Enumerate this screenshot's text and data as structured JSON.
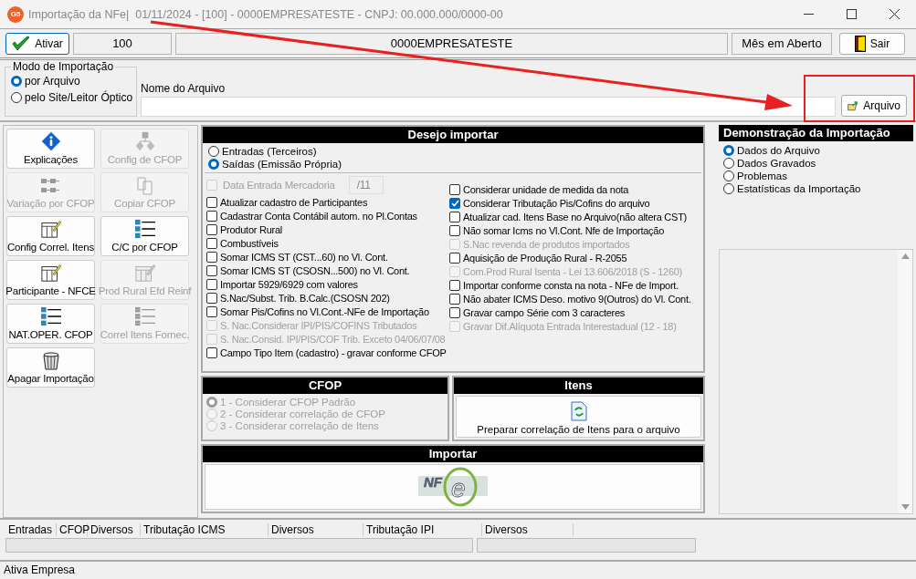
{
  "window": {
    "app_icon": "G5",
    "title": "Importação da NFe|  01/11/2024 - [100] - 0000EMPRESATESTE - CNPJ: 00.000.000/0000-00"
  },
  "toolbar": {
    "activate_button": "Ativar",
    "company_code": "100",
    "company_name": "0000EMPRESATESTE",
    "period_status": "Mês em Aberto",
    "exit_button": "Sair"
  },
  "import_mode": {
    "title": "Modo de Importação",
    "options": [
      {
        "label": "por Arquivo",
        "selected": true
      },
      {
        "label": "pelo Site/Leitor Óptico",
        "selected": false
      }
    ]
  },
  "file": {
    "label": "Nome do Arquivo",
    "button": "Arquivo"
  },
  "actions": [
    {
      "label": "Explicações",
      "disabled": false
    },
    {
      "label": "Config de CFOP",
      "disabled": true
    },
    {
      "label": "Variação por CFOP",
      "disabled": true
    },
    {
      "label": "Copiar CFOP",
      "disabled": true
    },
    {
      "label": "Config Correl. Itens",
      "disabled": false
    },
    {
      "label": "C/C por CFOP",
      "disabled": false
    },
    {
      "label": "Participante - NFCE",
      "disabled": false
    },
    {
      "label": "Prod Rural Efd Reinf",
      "disabled": true
    },
    {
      "label": "NAT.OPER. CFOP",
      "disabled": false
    },
    {
      "label": "Correl Itens Fornec.",
      "disabled": true
    },
    {
      "label": "Apagar Importação",
      "disabled": false
    }
  ],
  "import_options": {
    "title": "Desejo importar",
    "types": [
      {
        "label": "Entradas (Terceiros)",
        "selected": false
      },
      {
        "label": "Saídas (Emissão Própria)",
        "selected": true
      }
    ],
    "date_field": {
      "label": "Data Entrada Mercadoria",
      "value": "/11",
      "checked": false,
      "disabled": true
    },
    "left": [
      {
        "label": "Atualizar cadastro de Participantes",
        "checked": false,
        "disabled": false
      },
      {
        "label": "Cadastrar Conta Contábil autom. no Pl.Contas",
        "checked": false,
        "disabled": false
      },
      {
        "label": "Produtor Rural",
        "checked": false,
        "disabled": false
      },
      {
        "label": "Combustíveis",
        "checked": false,
        "disabled": false
      },
      {
        "label": "Somar ICMS ST (CST...60) no Vl. Cont.",
        "checked": false,
        "disabled": false
      },
      {
        "label": "Somar ICMS ST (CSOSN...500) no Vl. Cont.",
        "checked": false,
        "disabled": false
      },
      {
        "label": "Importar 5929/6929 com valores",
        "checked": false,
        "disabled": false
      },
      {
        "label": "S.Nac/Subst. Trib. B.Calc.(CSOSN 202)",
        "checked": false,
        "disabled": false
      },
      {
        "label": "Somar Pis/Cofins no Vl.Cont.-NFe de Importação",
        "checked": false,
        "disabled": false
      },
      {
        "label": "S. Nac.Considerar IPI/PIS/COFINS Tributados",
        "checked": false,
        "disabled": true
      },
      {
        "label": "S. Nac.Consid. IPI/PIS/COF Trib. Exceto 04/06/07/08",
        "checked": false,
        "disabled": true
      },
      {
        "label": "Campo Tipo Item (cadastro) - gravar conforme CFOP",
        "checked": false,
        "disabled": false
      }
    ],
    "right": [
      {
        "label": "Considerar unidade de medida da nota",
        "checked": false,
        "disabled": false
      },
      {
        "label": "Considerar Tributação Pis/Cofins do arquivo",
        "checked": true,
        "disabled": false
      },
      {
        "label": "Atualizar cad. Itens Base no Arquivo(não altera CST)",
        "checked": false,
        "disabled": false
      },
      {
        "label": "Não somar Icms no Vl.Cont. Nfe de Importação",
        "checked": false,
        "disabled": false
      },
      {
        "label": "S.Nac revenda de produtos importados",
        "checked": false,
        "disabled": true
      },
      {
        "label": "Aquisição de Produção Rural - R-2055",
        "checked": false,
        "disabled": false
      },
      {
        "label": "Com.Prod Rural Isenta - Lei 13.606/2018 (S - 1260)",
        "checked": false,
        "disabled": true
      },
      {
        "label": "Importar conforme consta na nota - NFe de Import.",
        "checked": false,
        "disabled": false
      },
      {
        "label": "Não abater ICMS Deso. motivo 9(Outros) do Vl. Cont.",
        "checked": false,
        "disabled": false
      },
      {
        "label": "Gravar campo Série com 3 caracteres",
        "checked": false,
        "disabled": false
      },
      {
        "label": "Gravar Dif.Alíquota Entrada Interestadual (12 - 18)",
        "checked": false,
        "disabled": true
      }
    ]
  },
  "cfop": {
    "title": "CFOP",
    "options": [
      {
        "label": "1 - Considerar CFOP Padrão",
        "selected": true,
        "disabled": true
      },
      {
        "label": "2 - Considerar correlação de CFOP",
        "selected": false,
        "disabled": true
      },
      {
        "label": "3 - Considerar correlação de Itens",
        "selected": false,
        "disabled": true
      }
    ]
  },
  "items": {
    "title": "Itens",
    "button": "Preparar correlação de Itens para o arquivo"
  },
  "import": {
    "title": "Importar",
    "logo": {
      "text": "NF",
      "mark": "e"
    }
  },
  "summary": {
    "title": "Demonstração da Importação",
    "options": [
      {
        "label": "Dados do Arquivo",
        "selected": true
      },
      {
        "label": "Dados Gravados",
        "selected": false
      },
      {
        "label": "Problemas",
        "selected": false
      },
      {
        "label": "Estatísticas da Importação",
        "selected": false
      }
    ]
  },
  "totals": {
    "columns": [
      "Entradas",
      "CFOP",
      "Diversos",
      "Tributação ICMS",
      "Diversos",
      "Tributação IPI",
      "Diversos"
    ]
  },
  "status_bar": {
    "text": "Ativa Empresa"
  }
}
